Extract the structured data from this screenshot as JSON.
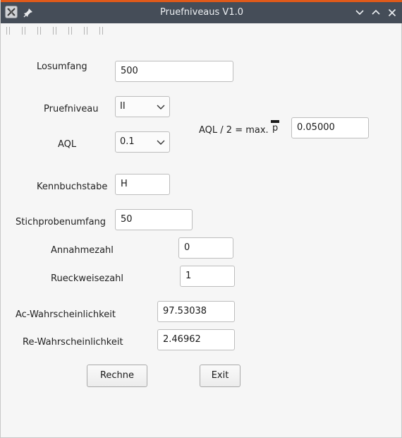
{
  "window": {
    "title": "Pruefniveaus V1.0",
    "accent_color": "#e05a1a",
    "titlebar_color": "#454d58"
  },
  "form": {
    "losumfang": {
      "label": "Losumfang",
      "value": "500"
    },
    "pruefniveau": {
      "label": "Pruefniveau",
      "value": "II"
    },
    "aql": {
      "label": "AQL",
      "value": "0.1"
    },
    "aql_half": {
      "label": "AQL / 2 = max.",
      "symbol": "p",
      "value": "0.05000"
    },
    "kennbuchstabe": {
      "label": "Kennbuchstabe",
      "value": "H"
    },
    "stichprobenumfang": {
      "label": "Stichprobenumfang",
      "value": "50"
    },
    "annahmezahl": {
      "label": "Annahmezahl",
      "value": "0"
    },
    "rueckweisezahl": {
      "label": "Rueckweisezahl",
      "value": "1"
    },
    "ac_wahrscheinlichkeit": {
      "label": "Ac-Wahrscheinlichkeit",
      "value": "97.53038"
    },
    "re_wahrscheinlichkeit": {
      "label": "Re-Wahrscheinlichkeit",
      "value": "2.46962"
    }
  },
  "buttons": {
    "rechne": "Rechne",
    "exit": "Exit"
  },
  "icons": {
    "app": "app-x-icon",
    "pin": "pin-icon",
    "minimize": "chevron-down-icon",
    "maximize": "chevron-up-icon",
    "close": "close-icon",
    "combo": "chevron-down-icon"
  }
}
